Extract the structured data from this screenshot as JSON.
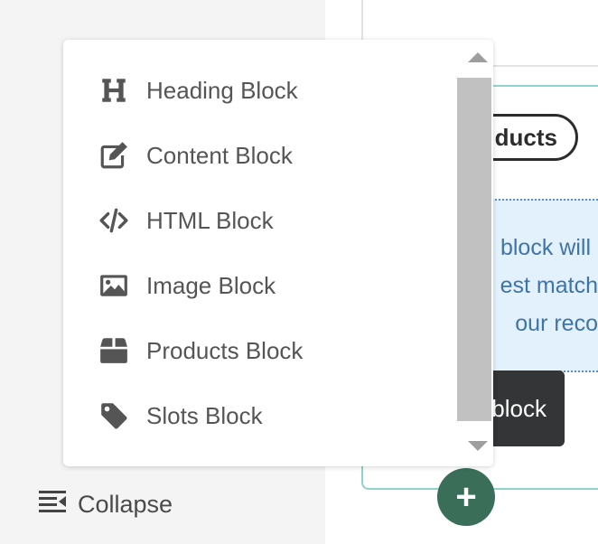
{
  "sidebar": {
    "collapse_label": "Collapse",
    "collapse_icon": "collapse-left-icon"
  },
  "block_menu": {
    "items": [
      {
        "label": "Heading Block",
        "icon": "heading-icon"
      },
      {
        "label": "Content Block",
        "icon": "edit-icon"
      },
      {
        "label": "HTML Block",
        "icon": "code-icon"
      },
      {
        "label": "Image Block",
        "icon": "image-icon"
      },
      {
        "label": "Products Block",
        "icon": "box-icon"
      },
      {
        "label": "Slots Block",
        "icon": "tag-icon"
      }
    ]
  },
  "canvas": {
    "products_pill_text": "ducts",
    "info_lines": [
      "block will",
      "est match",
      "our reco"
    ],
    "dark_button_text": "block",
    "add_button_symbol": "+"
  },
  "colors": {
    "accent_green": "#3a6e59",
    "frame_teal": "#8fd4ca",
    "info_blue_bg": "#e2f1fc",
    "info_blue_text": "#3f74a8",
    "dark_button": "#333536",
    "icon_gray": "#555555"
  }
}
